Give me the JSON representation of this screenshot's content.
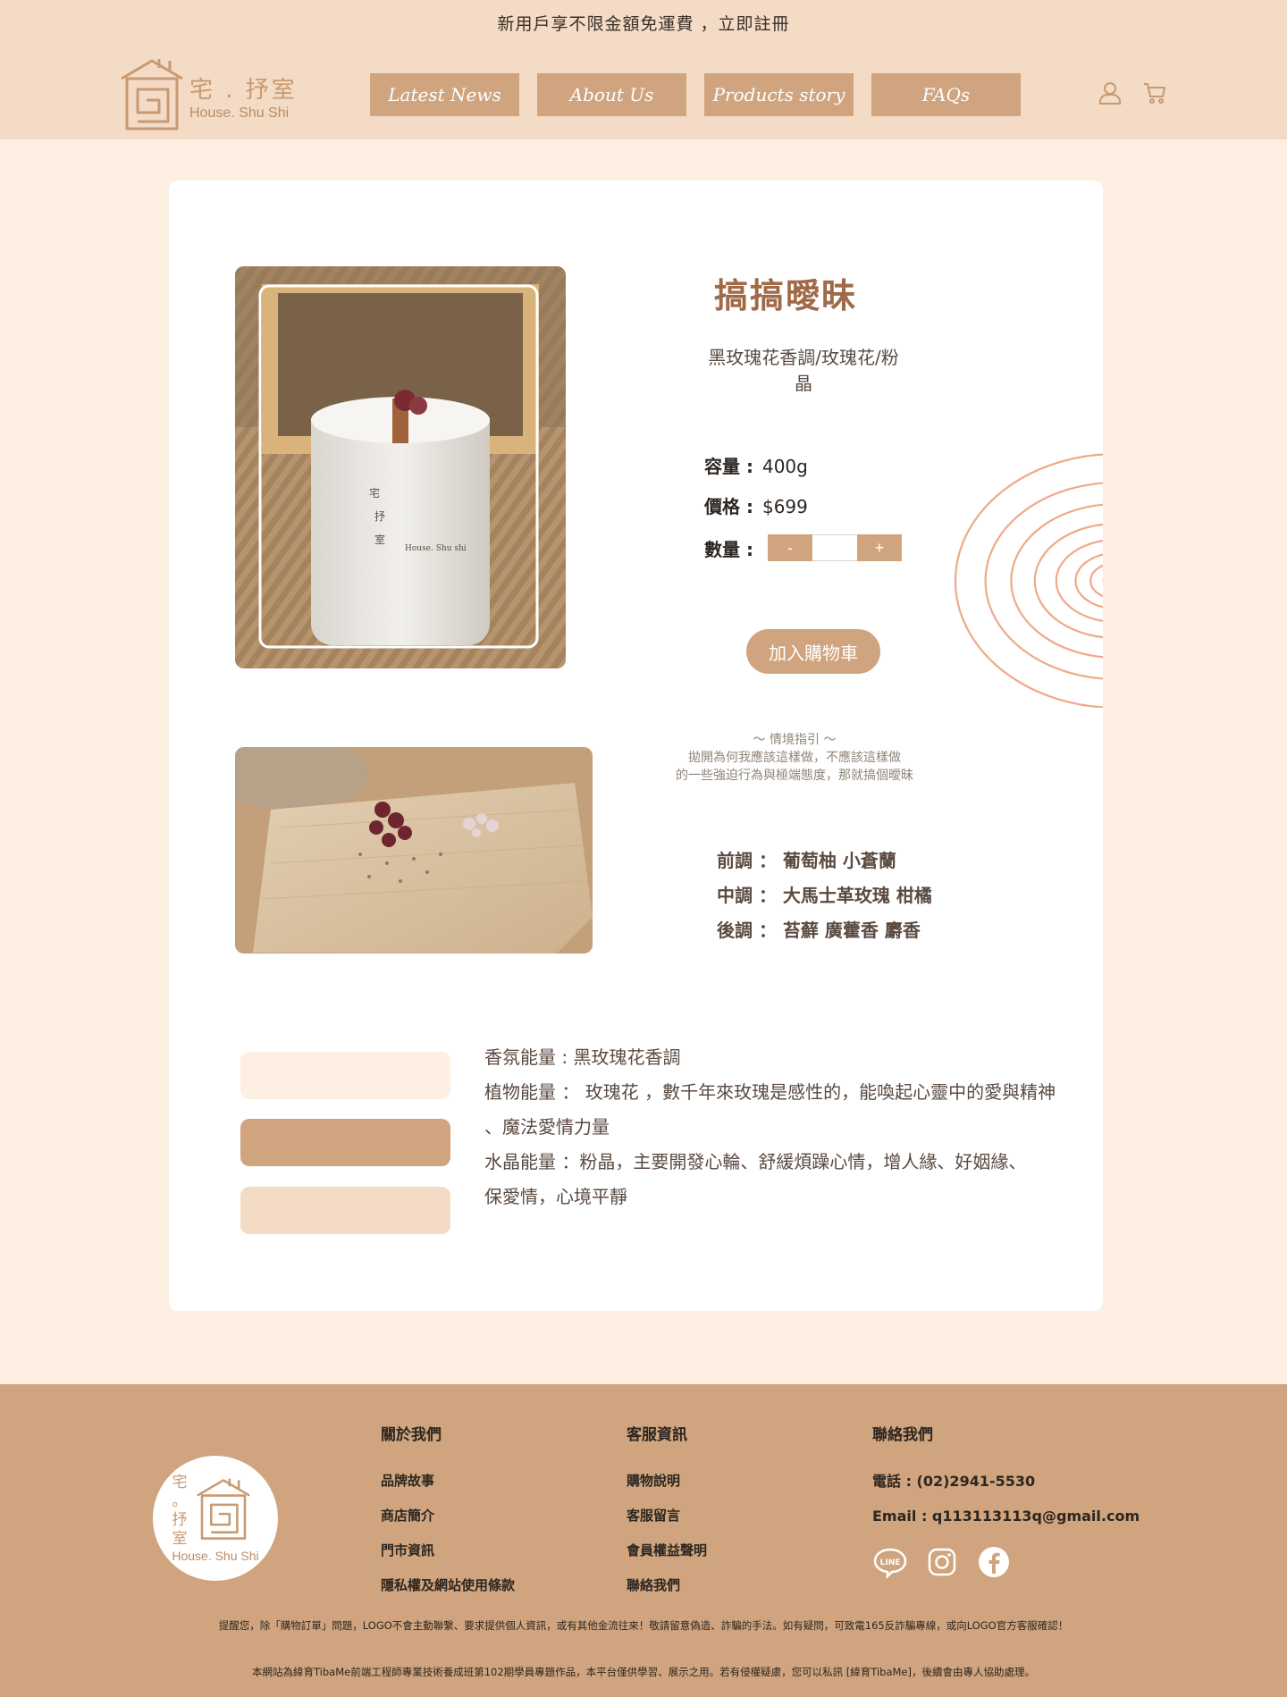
{
  "header": {
    "announcement": "新用戶享不限金額免運費 ，立即註冊",
    "logo_cn": "宅 . 抒室",
    "logo_en": "House. Shu Shi",
    "nav": [
      "Latest News",
      "About Us",
      "Products story",
      "FAQs"
    ],
    "icons": [
      "user-icon",
      "cart-icon"
    ]
  },
  "product": {
    "title": "搞搞曖昧",
    "subtitle_line1": "黑玫瑰花香調/玫瑰花/粉",
    "subtitle_line2": "晶",
    "capacity_label": "容量 :",
    "capacity_value": "400g",
    "price_label": "價格 :",
    "price_value": "$699",
    "qty_label": "數量 :",
    "qty_minus": "-",
    "qty_plus": "+",
    "qty_value": "",
    "add_to_cart": "加入購物車",
    "hint": [
      "～ 情境指引 ～",
      "拋開為何我應該這樣做，不應該這樣做",
      "的一些強迫行為與極端態度，那就搞個曖昧"
    ],
    "notes": [
      "前調 ： 葡萄柚 小蒼蘭",
      "中調 ： 大馬士革玫瑰 柑橘",
      "後調 ： 苔蘚 廣藿香 麝香"
    ],
    "energy": [
      "香氛能量 : 黑玫瑰花香調",
      "植物能量 ： 玫瑰花 ，數千年來玫瑰是感性的，能喚起心靈中的愛與精神",
      "、魔法愛情力量",
      "水晶能量 ：粉晶，主要開發心輪、舒緩煩躁心情，增人緣、好姻緣、",
      "保愛情，心境平靜"
    ],
    "photo1_label_lines": [
      "宅",
      "抒",
      "室"
    ],
    "photo1_label_en": "House. Shu shi",
    "colors": {
      "swatch1": "#fdefe2",
      "swatch2": "#cfa47e",
      "swatch3": "#f3dbc5",
      "accent": "#cfa47e",
      "rings": "#f0a88a"
    }
  },
  "footer": {
    "logo_cn_lines": [
      "宅",
      "。",
      "抒",
      "室"
    ],
    "logo_en": "House. Shu Shi",
    "col1": {
      "title": "關於我們",
      "links": [
        "品牌故事",
        "商店簡介",
        "門市資訊",
        "隱私權及網站使用條款"
      ]
    },
    "col2": {
      "title": "客服資訊",
      "links": [
        "購物說明",
        "客服留言",
        "會員權益聲明",
        "聯絡我們"
      ]
    },
    "col3": {
      "title": "聯絡我們",
      "phone": "電話 : (02)2941-5530",
      "email": "Email : q113113113q@gmail.com",
      "socials": [
        "line-icon",
        "instagram-icon",
        "facebook-icon"
      ]
    },
    "disclaimer1": "提醒您，除「購物訂單」問題，LOGO不會主動聯繫、要求提供個人資訊，或有其他金流往來！敬請留意偽造、詐騙的手法。如有疑問，可致電165反詐騙專線，或向LOGO官方客服確認！",
    "disclaimer2": "本網站為緯育TibaMe前端工程師專業技術養成班第102期學員專題作品，本平台僅供學習、展示之用。若有侵權疑慮，您可以私訊 [緯育TibaMe]，後續會由專人協助處理。"
  }
}
